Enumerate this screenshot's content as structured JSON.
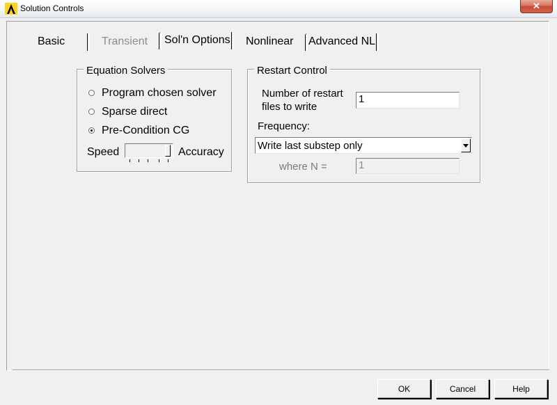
{
  "window": {
    "title": "Solution Controls",
    "close_glyph": "✕",
    "icon": "ansys-logo-icon"
  },
  "tabs": [
    {
      "label": "Basic",
      "state": "enabled"
    },
    {
      "label": "Transient",
      "state": "disabled"
    },
    {
      "label": "Sol'n Options",
      "state": "active"
    },
    {
      "label": "Nonlinear",
      "state": "enabled"
    },
    {
      "label": "Advanced NL",
      "state": "enabled"
    }
  ],
  "equation_solvers": {
    "title": "Equation Solvers",
    "options": [
      {
        "label": "Program chosen solver",
        "checked": false
      },
      {
        "label": "Sparse direct",
        "checked": false
      },
      {
        "label": "Pre-Condition CG",
        "checked": true
      }
    ],
    "speed_label": "Speed",
    "accuracy_label": "Accuracy",
    "slider_level": 1.0
  },
  "restart_control": {
    "title": "Restart Control",
    "num_files_label_line1": "Number of restart",
    "num_files_label_line2": "files to write",
    "num_files_value": "1",
    "frequency_label": "Frequency:",
    "frequency_value": "Write last substep only",
    "where_n_label": "where N =",
    "where_n_value": "1"
  },
  "buttons": {
    "ok": "OK",
    "cancel": "Cancel",
    "help": "Help"
  }
}
